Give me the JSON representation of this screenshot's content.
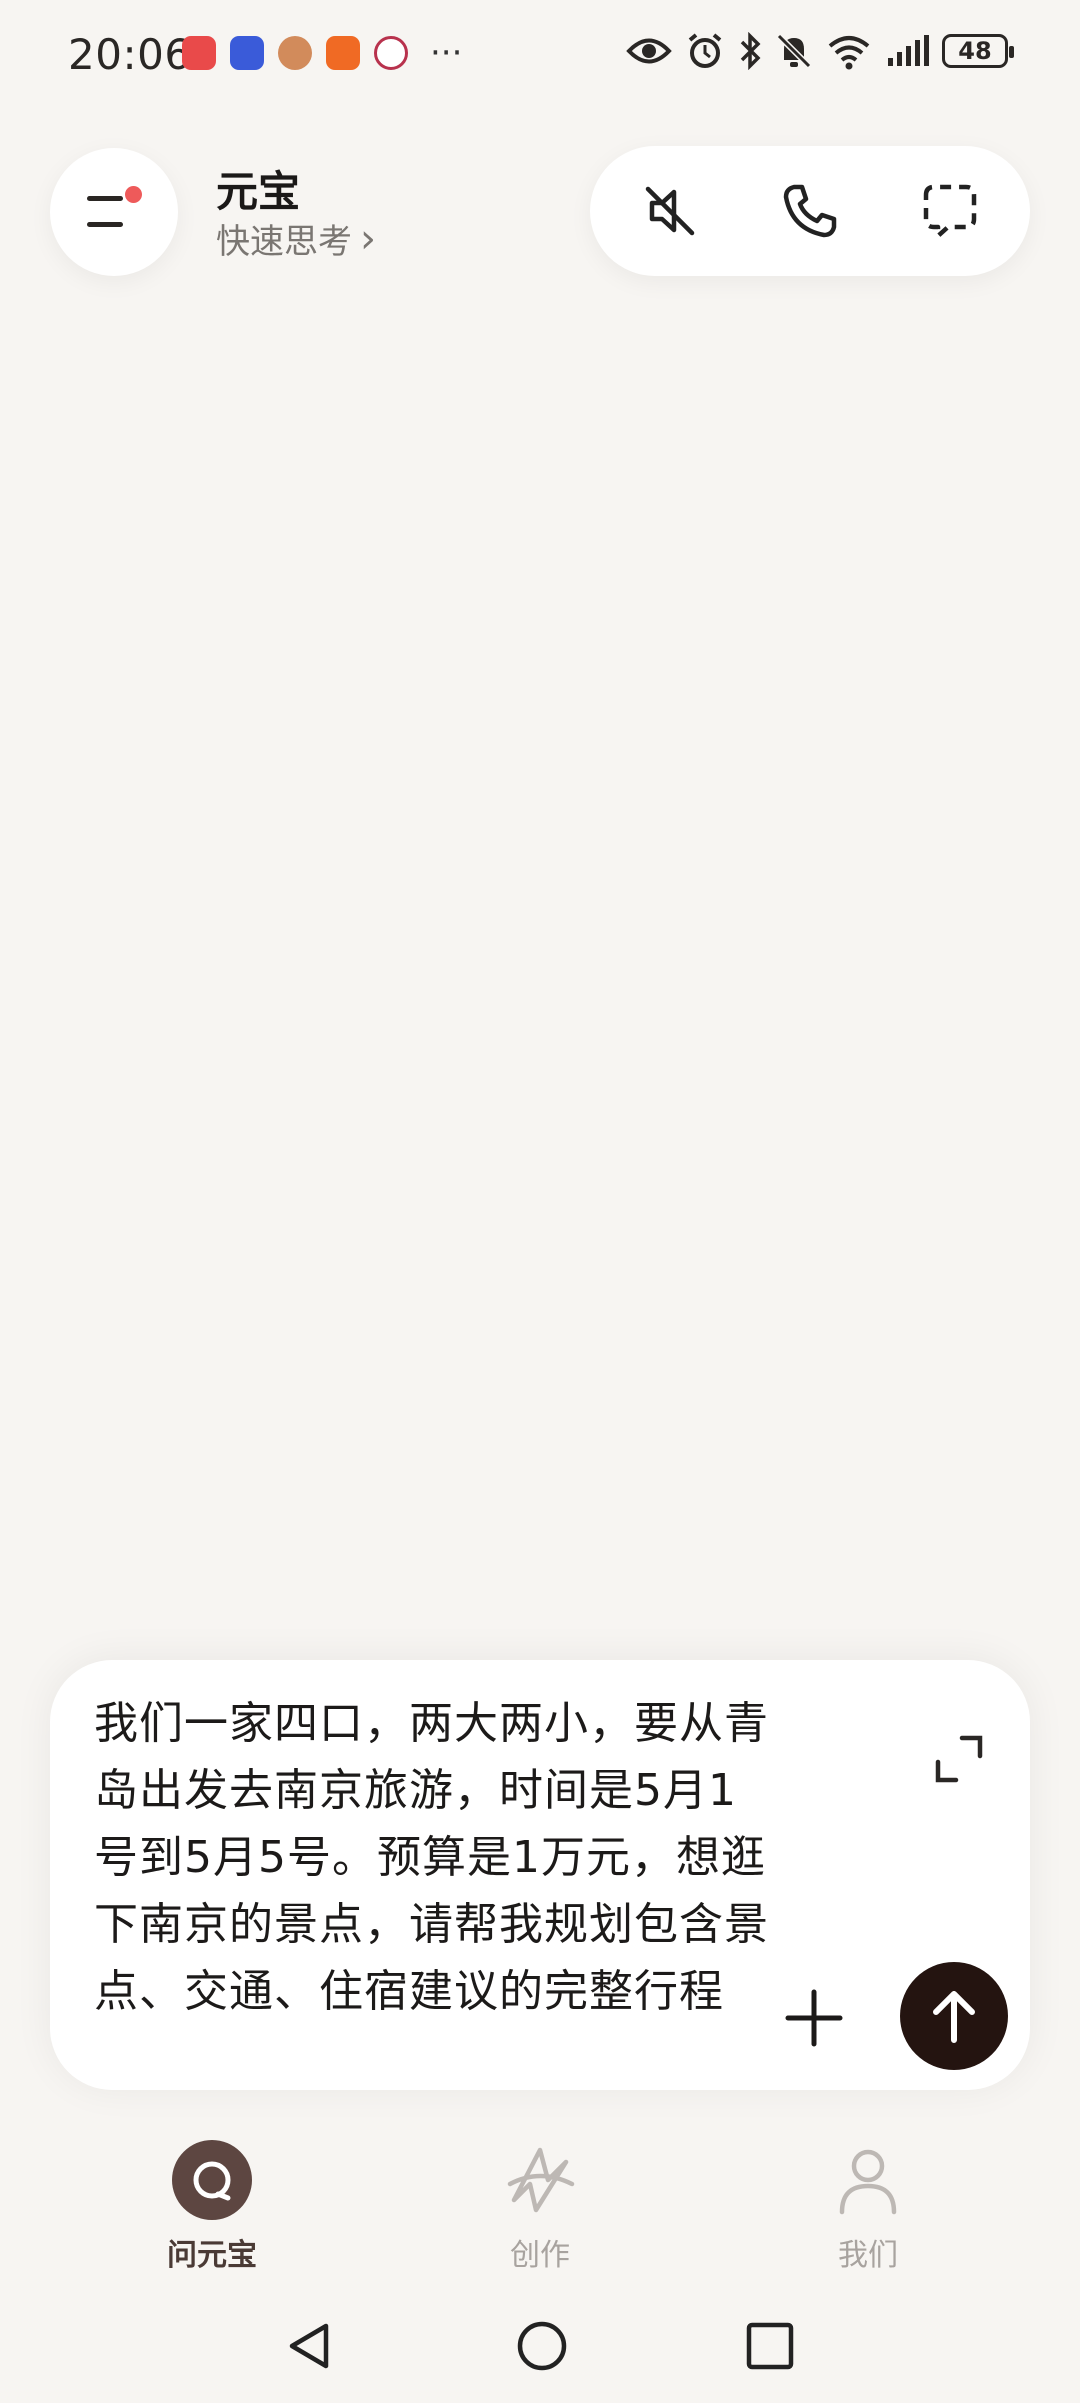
{
  "status_bar": {
    "time": "20:06",
    "battery": "48",
    "more": "···",
    "app_icon_colors": [
      "#e94a4a",
      "#3a5bd9",
      "#d28b5b",
      "#f06a24",
      "#b8324d"
    ]
  },
  "header": {
    "title": "元宝",
    "subtitle": "快速思考",
    "subtitle_chevron": "›"
  },
  "input": {
    "text": "我们一家四口，两大两小，要从青岛出发去南京旅游，时间是5月1号到5月5号。预算是1万元，想逛下南京的景点，请帮我规划包含景点、交通、住宿建议的完整行程"
  },
  "tabs": [
    {
      "label": "问元宝",
      "icon": "chat-bubble-icon",
      "active": true
    },
    {
      "label": "创作",
      "icon": "create-sparkle-icon",
      "active": false
    },
    {
      "label": "我们",
      "icon": "person-icon",
      "active": false
    }
  ],
  "colors": {
    "background": "#f7f5f2",
    "accent_dark": "#241410",
    "notification_dot": "#ee5a5a",
    "active_tab": "#5d4641"
  }
}
